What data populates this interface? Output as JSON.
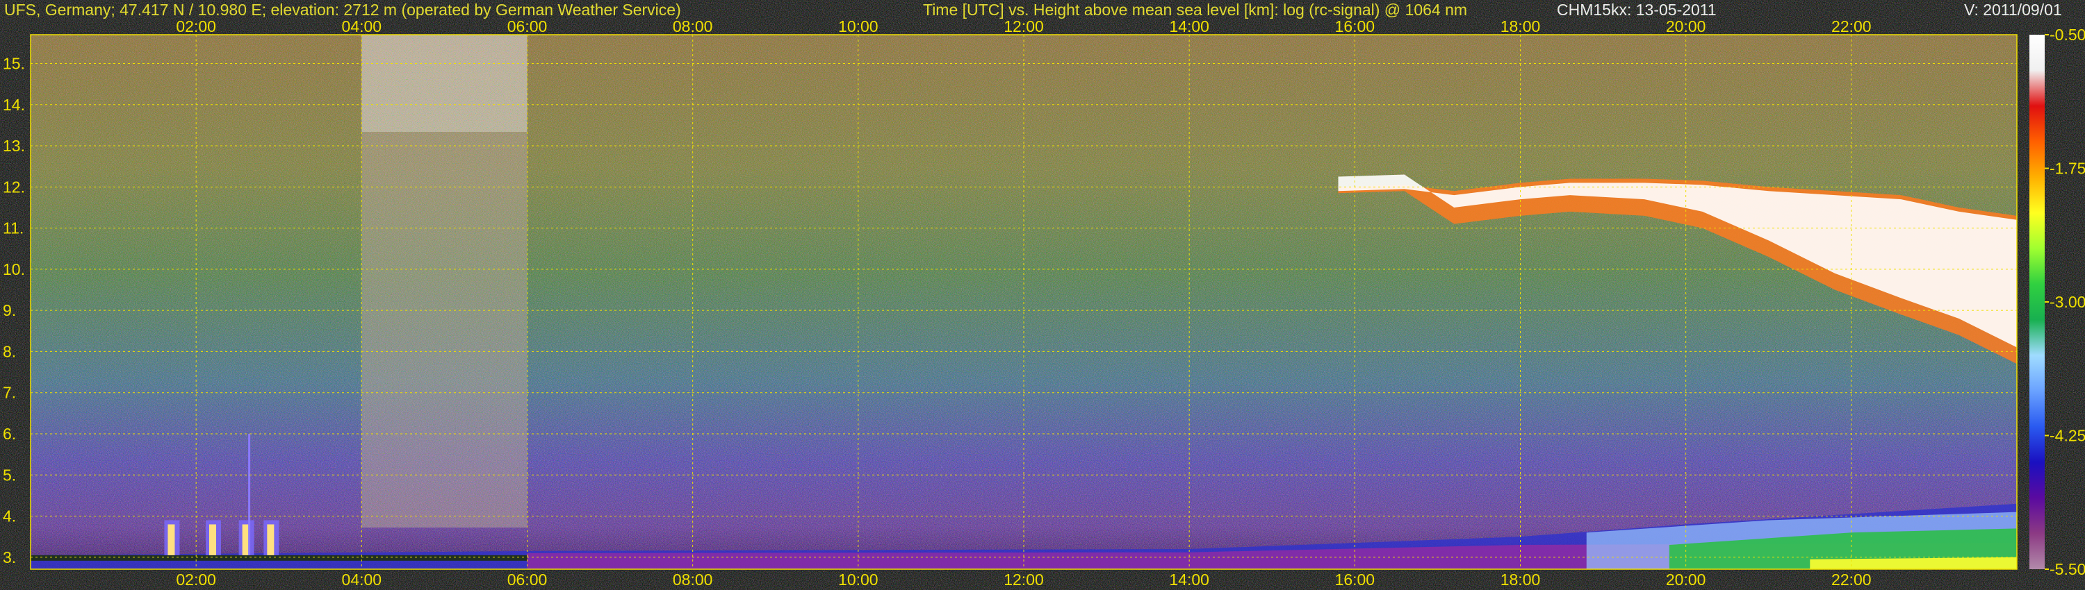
{
  "header": {
    "station": "UFS, Germany; 47.417 N / 10.980 E; elevation: 2712 m  (operated by German Weather Service)",
    "axes_description": "Time [UTC] vs. Height above mean sea level [km]: log (rc-signal) @ 1064 nm",
    "instrument_date": "CHM15kx: 13-05-2011",
    "version": "V: 2011/09/01"
  },
  "chart_data": {
    "type": "heatmap",
    "title": "",
    "xlabel": "Time [UTC]",
    "ylabel": "Height above mean sea level [km]",
    "quantity": "log (rc-signal) @ 1064 nm",
    "x_range_hours": [
      0,
      24
    ],
    "y_range_km": [
      2.71,
      15.7
    ],
    "x_ticks": [
      "02:00",
      "04:00",
      "06:00",
      "08:00",
      "10:00",
      "12:00",
      "14:00",
      "16:00",
      "18:00",
      "20:00",
      "22:00"
    ],
    "x_tick_hours": [
      2,
      4,
      6,
      8,
      10,
      12,
      14,
      16,
      18,
      20,
      22
    ],
    "y_ticks": [
      "3.",
      "4.",
      "5.",
      "6.",
      "7.",
      "8.",
      "9.",
      "10.",
      "11.",
      "12.",
      "13.",
      "14.",
      "15."
    ],
    "y_tick_km": [
      3,
      4,
      5,
      6,
      7,
      8,
      9,
      10,
      11,
      12,
      13,
      14,
      15
    ],
    "grid": true,
    "colorbar": {
      "range": [
        -5.5,
        -0.5
      ],
      "ticks": [
        "-0.50",
        "-1.75",
        "-3.00",
        "-4.25",
        "-5.50"
      ],
      "tick_values": [
        -0.5,
        -1.75,
        -3.0,
        -4.25,
        -5.5
      ],
      "colors": [
        "#b28aaa",
        "#8c3a84",
        "#5a0aa0",
        "#1a10c0",
        "#2a5af0",
        "#6aa2ff",
        "#a0dcff",
        "#18b050",
        "#30d040",
        "#a0ff30",
        "#ffff20",
        "#ffb000",
        "#ff6000",
        "#e01010",
        "#f0f0f0",
        "#ffffff"
      ]
    },
    "features": [
      {
        "name": "Cirrus cloud layer",
        "start_hour": 15.8,
        "end_hour": 24,
        "base_km": [
          11.6,
          7.7
        ],
        "top_km": [
          12.2,
          11.3
        ]
      },
      {
        "name": "Boundary layer aerosol",
        "start_hour": 0,
        "end_hour": 24,
        "top_km": [
          3.0,
          4.3
        ]
      },
      {
        "name": "Low clouds",
        "hours": [
          1.7,
          2.2,
          2.6,
          2.9
        ],
        "top_km": 3.9
      }
    ]
  }
}
